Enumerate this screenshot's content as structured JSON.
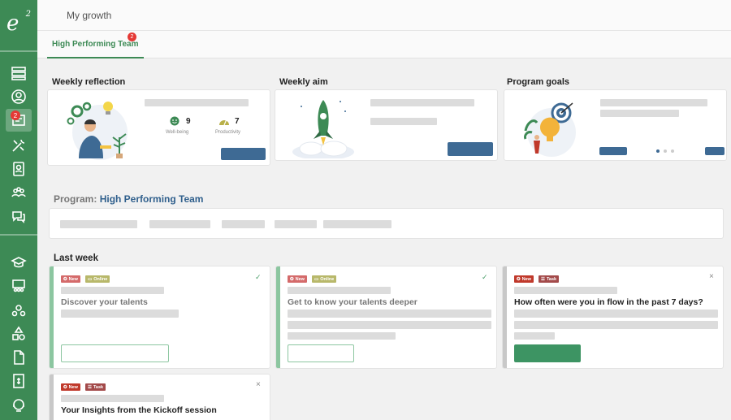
{
  "app": {
    "logo_text": "e",
    "logo_sup": "2"
  },
  "sidebar": {
    "badge": "2",
    "icons": [
      "layers-icon",
      "user-circle-icon",
      "team-board-icon",
      "tools-icon",
      "contact-card-icon",
      "people-group-icon",
      "chat-icon",
      "graduation-icon",
      "presentation-icon",
      "gears-people-icon",
      "shapes-icon",
      "document-icon",
      "invoice-icon",
      "support-icon"
    ]
  },
  "header": {
    "title": "My growth"
  },
  "tabs": [
    {
      "label": "High Performing Team",
      "badge": "2"
    }
  ],
  "sections": {
    "weekly_reflection": "Weekly reflection",
    "weekly_aim": "Weekly aim",
    "program_goals": "Program goals",
    "last_week": "Last week"
  },
  "reflection": {
    "wellbeing_value": "9",
    "wellbeing_label": "Well-being",
    "productivity_value": "7",
    "productivity_label": "Productivity"
  },
  "program": {
    "prefix": "Program: ",
    "name": "High Performing Team"
  },
  "activities": [
    {
      "tags": [
        "New",
        "Online"
      ],
      "title": "Discover your talents",
      "done": "✓"
    },
    {
      "tags": [
        "New",
        "Online"
      ],
      "title": "Get to know your talents deeper",
      "done": "✓"
    },
    {
      "tags": [
        "New",
        "Task"
      ],
      "title": "How often were you in flow in the past 7 days?",
      "close": "×"
    },
    {
      "tags": [
        "New",
        "Task"
      ],
      "title": "Your Insights from the Kickoff session",
      "close": "×"
    }
  ],
  "colors": {
    "brand_green": "#3d8a55",
    "accent_blue": "#3e6a94",
    "tag_red": "#c0392b",
    "tag_olive": "#b8b86a",
    "tag_task": "#a34a4a"
  }
}
